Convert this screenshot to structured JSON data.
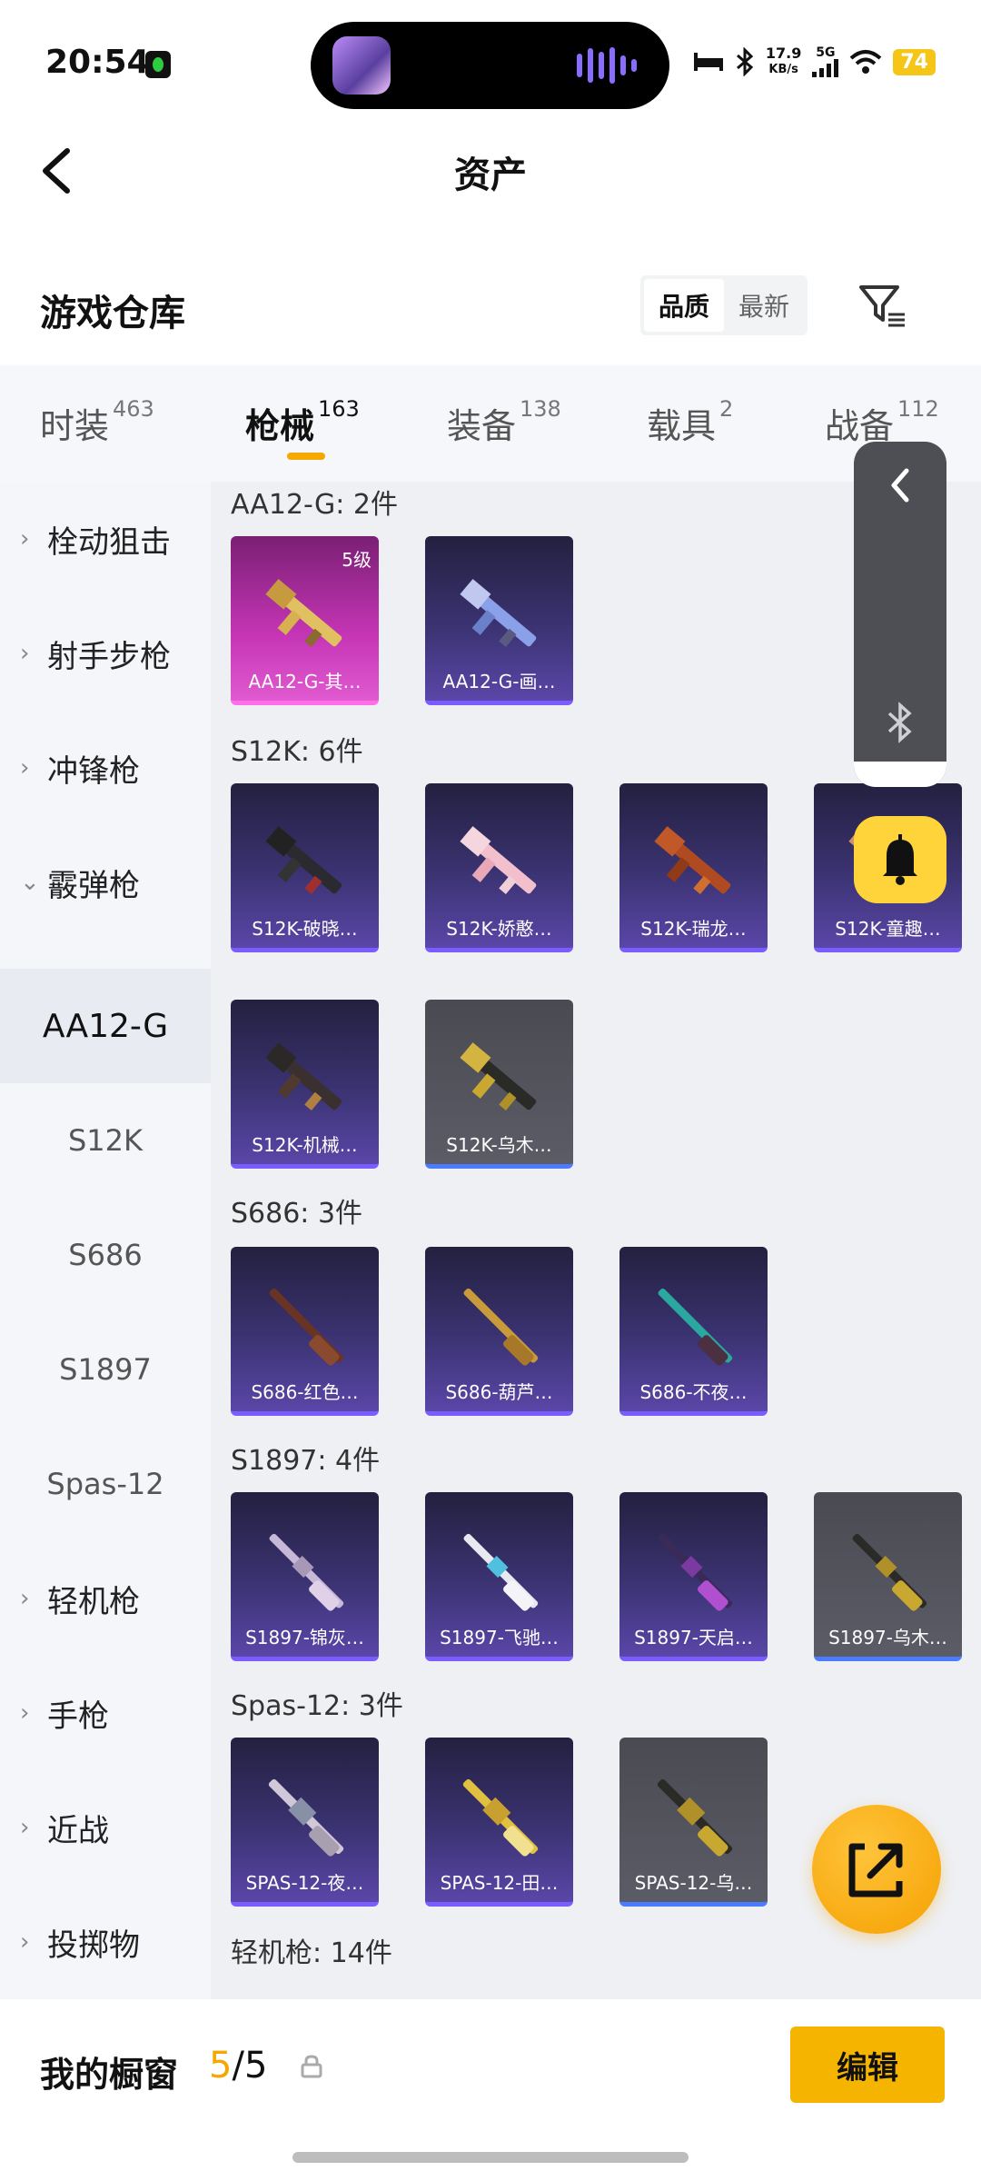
{
  "status_bar": {
    "time": "20:54",
    "net_speed": "17.9",
    "net_unit": "KB/s",
    "net_type": "5G",
    "battery": "74"
  },
  "header": {
    "back_icon": "chevron-left-icon",
    "title": "资产"
  },
  "warehouse": {
    "title": "游戏仓库",
    "sort_options": [
      {
        "label": "品质",
        "active": true
      },
      {
        "label": "最新",
        "active": false
      }
    ],
    "filter_icon": "filter-icon"
  },
  "tabs": [
    {
      "label": "时装",
      "count": "463",
      "active": false
    },
    {
      "label": "枪械",
      "count": "163",
      "active": true
    },
    {
      "label": "装备",
      "count": "138",
      "active": false
    },
    {
      "label": "载具",
      "count": "2",
      "active": false
    },
    {
      "label": "战备",
      "count": "112",
      "active": false
    }
  ],
  "sidebar": [
    {
      "label": "栓动狙击",
      "chev": "›"
    },
    {
      "label": "射手步枪",
      "chev": "›"
    },
    {
      "label": "冲锋枪",
      "chev": "›"
    },
    {
      "label": "霰弹枪",
      "chev": "⌄"
    },
    {
      "label": "AA12-G"
    },
    {
      "label": "S12K"
    },
    {
      "label": "S686"
    },
    {
      "label": "S1897"
    },
    {
      "label": "Spas-12"
    },
    {
      "label": "轻机枪",
      "chev": "›"
    },
    {
      "label": "手枪",
      "chev": "›"
    },
    {
      "label": "近战",
      "chev": "›"
    },
    {
      "label": "投掷物",
      "chev": "›"
    }
  ],
  "sections": [
    {
      "title": "AA12-G: 2件",
      "items": [
        {
          "name": "AA12-G-其…",
          "level": "5级"
        },
        {
          "name": "AA12-G-画…"
        }
      ]
    },
    {
      "title": "S12K: 6件",
      "items": [
        {
          "name": "S12K-破晓…"
        },
        {
          "name": "S12K-娇憨…"
        },
        {
          "name": "S12K-瑞龙…"
        },
        {
          "name": "S12K-童趣…"
        },
        {
          "name": "S12K-机械…"
        },
        {
          "name": "S12K-乌木…"
        }
      ]
    },
    {
      "title": "S686: 3件",
      "items": [
        {
          "name": "S686-红色…"
        },
        {
          "name": "S686-葫芦…"
        },
        {
          "name": "S686-不夜…"
        }
      ]
    },
    {
      "title": "S1897: 4件",
      "items": [
        {
          "name": "S1897-锦灰…"
        },
        {
          "name": "S1897-飞驰…"
        },
        {
          "name": "S1897-天启…"
        },
        {
          "name": "S1897-乌木…"
        }
      ]
    },
    {
      "title": "Spas-12: 3件",
      "items": [
        {
          "name": "SPAS-12-夜…"
        },
        {
          "name": "SPAS-12-田…"
        },
        {
          "name": "SPAS-12-乌…"
        }
      ]
    },
    {
      "title": "轻机枪: 14件",
      "items": []
    }
  ],
  "floating": {
    "panel_icon": "chevron-left-icon",
    "bluetooth_icon": "bluetooth-icon",
    "bell_icon": "bell-icon",
    "share_icon": "share-icon"
  },
  "showcase": {
    "label": "我的橱窗",
    "current": "5",
    "separator": "/",
    "total": "5",
    "edit_label": "编辑"
  }
}
